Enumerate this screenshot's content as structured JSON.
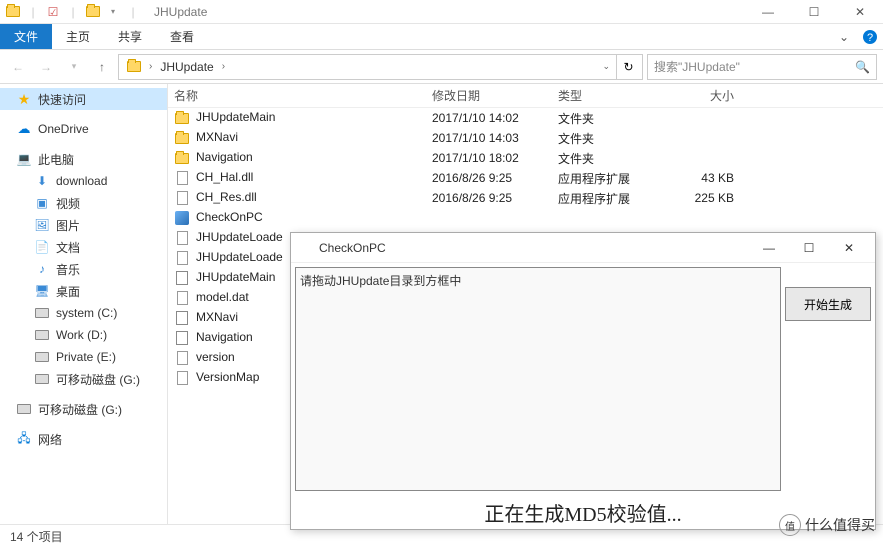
{
  "titlebar": {
    "title": "JHUpdate"
  },
  "ribbon": {
    "file": "文件",
    "tabs": [
      "主页",
      "共享",
      "查看"
    ]
  },
  "nav": {
    "breadcrumb": [
      "JHUpdate"
    ],
    "search_placeholder": "搜索\"JHUpdate\""
  },
  "sidebar": {
    "quick_access": "快速访问",
    "onedrive": "OneDrive",
    "this_pc": "此电脑",
    "children": [
      {
        "label": "download",
        "icon": "download"
      },
      {
        "label": "视频",
        "icon": "video"
      },
      {
        "label": "图片",
        "icon": "picture"
      },
      {
        "label": "文档",
        "icon": "document"
      },
      {
        "label": "音乐",
        "icon": "music"
      },
      {
        "label": "桌面",
        "icon": "desktop"
      },
      {
        "label": "system (C:)",
        "icon": "drive"
      },
      {
        "label": "Work (D:)",
        "icon": "drive"
      },
      {
        "label": "Private (E:)",
        "icon": "drive"
      },
      {
        "label": "可移动磁盘 (G:)",
        "icon": "drive"
      }
    ],
    "removable": "可移动磁盘 (G:)",
    "network": "网络"
  },
  "columns": {
    "name": "名称",
    "date": "修改日期",
    "type": "类型",
    "size": "大小"
  },
  "files": [
    {
      "name": "JHUpdateMain",
      "date": "2017/1/10 14:02",
      "type": "文件夹",
      "size": "",
      "icon": "folder"
    },
    {
      "name": "MXNavi",
      "date": "2017/1/10 14:03",
      "type": "文件夹",
      "size": "",
      "icon": "folder"
    },
    {
      "name": "Navigation",
      "date": "2017/1/10 18:02",
      "type": "文件夹",
      "size": "",
      "icon": "folder"
    },
    {
      "name": "CH_Hal.dll",
      "date": "2016/8/26 9:25",
      "type": "应用程序扩展",
      "size": "43 KB",
      "icon": "dll"
    },
    {
      "name": "CH_Res.dll",
      "date": "2016/8/26 9:25",
      "type": "应用程序扩展",
      "size": "225 KB",
      "icon": "dll"
    },
    {
      "name": "CheckOnPC",
      "date": "",
      "type": "",
      "size": "",
      "icon": "exe"
    },
    {
      "name": "JHUpdateLoade",
      "date": "",
      "type": "",
      "size": "",
      "icon": "file"
    },
    {
      "name": "JHUpdateLoade",
      "date": "",
      "type": "",
      "size": "",
      "icon": "file"
    },
    {
      "name": "JHUpdateMain",
      "date": "",
      "type": "",
      "size": "",
      "icon": "bat"
    },
    {
      "name": "model.dat",
      "date": "",
      "type": "",
      "size": "",
      "icon": "file"
    },
    {
      "name": "MXNavi",
      "date": "",
      "type": "",
      "size": "",
      "icon": "bat"
    },
    {
      "name": "Navigation",
      "date": "",
      "type": "",
      "size": "",
      "icon": "bat"
    },
    {
      "name": "version",
      "date": "",
      "type": "",
      "size": "",
      "icon": "file"
    },
    {
      "name": "VersionMap",
      "date": "",
      "type": "",
      "size": "",
      "icon": "file"
    }
  ],
  "status": {
    "item_count": "14 个项目"
  },
  "dialog": {
    "title": "CheckOnPC",
    "hint": "请拖动JHUpdate目录到方框中",
    "button": "开始生成",
    "progress": "正在生成MD5校验值..."
  },
  "watermark": "什么值得买"
}
